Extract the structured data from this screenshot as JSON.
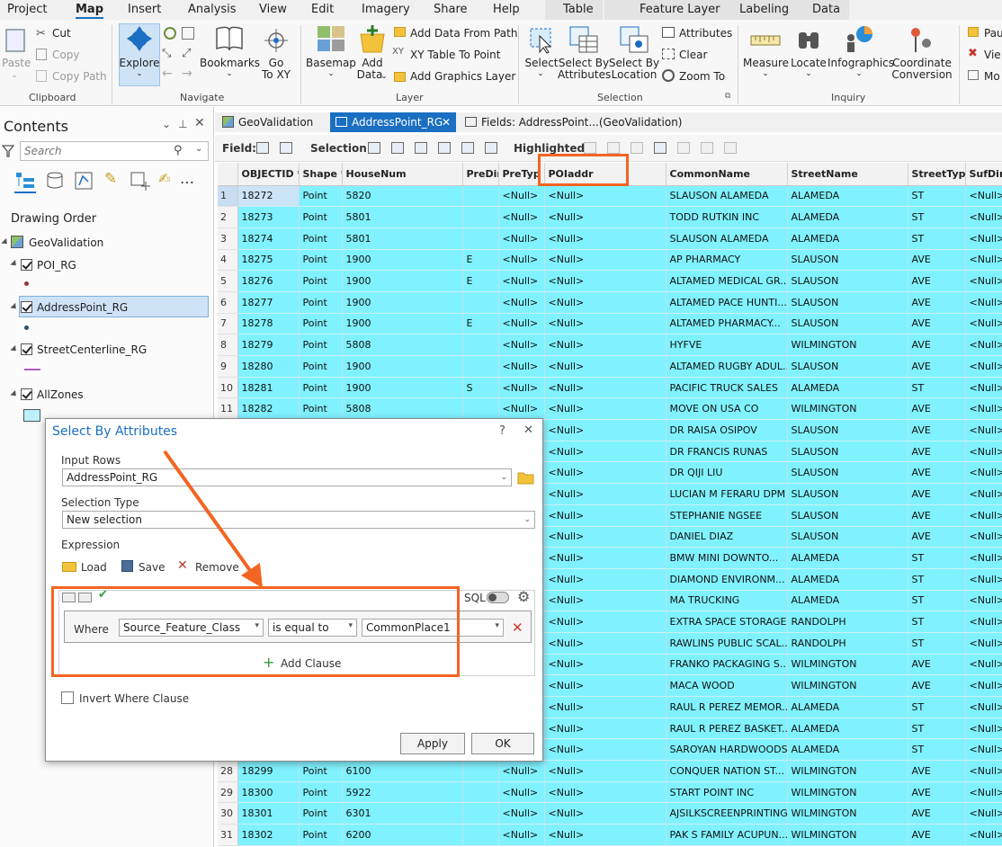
{
  "menu": {
    "items": [
      "Project",
      "Map",
      "Insert",
      "Analysis",
      "View",
      "Edit",
      "Imagery",
      "Share",
      "Help"
    ],
    "contextual": [
      "Table",
      "Feature Layer",
      "Labeling",
      "Data"
    ]
  },
  "ribbon": {
    "clipboard": {
      "paste": "Paste",
      "cut": "Cut",
      "copy": "Copy",
      "copy_path": "Copy Path",
      "label": "Clipboard"
    },
    "navigate": {
      "explore": "Explore",
      "bookmarks": "Bookmarks",
      "goto_xy": [
        "Go",
        "To XY"
      ],
      "label": "Navigate"
    },
    "layer": {
      "basemap": "Basemap",
      "add_data": [
        "Add",
        "Data"
      ],
      "add_data_from_path": "Add Data From Path",
      "xy_table_to_point": "XY Table To Point",
      "add_graphics_layer": "Add Graphics Layer",
      "label": "Layer"
    },
    "selection": {
      "select": "Select",
      "select_by_attributes": [
        "Select By",
        "Attributes"
      ],
      "select_by_location": [
        "Select By",
        "Location"
      ],
      "attributes": "Attributes",
      "clear": "Clear",
      "zoom_to": "Zoom To",
      "label": "Selection"
    },
    "inquiry": {
      "measure": "Measure",
      "locate": "Locate",
      "infographics": "Infographics",
      "coordinate_conversion": [
        "Coordinate",
        "Conversion"
      ],
      "label": "Inquiry"
    },
    "overflow": {
      "pause": "Pau",
      "view": "Vie",
      "more": "Mo"
    }
  },
  "contents": {
    "title": "Contents",
    "search_placeholder": "Search",
    "drawing_order": "Drawing Order",
    "map": "GeoValidation",
    "layers": [
      {
        "name": "POI_RG",
        "symbol_color": "#8b3a3a"
      },
      {
        "name": "AddressPoint_RG",
        "symbol_color": "#2d4f6b"
      },
      {
        "name": "StreetCenterline_RG",
        "symbol_color": "#b05cc8"
      },
      {
        "name": "AllZones",
        "symbol_color": "#bdf0ff"
      }
    ]
  },
  "tabs": [
    {
      "label": "GeoValidation",
      "active": false
    },
    {
      "label": "AddressPoint_RG",
      "active": true
    },
    {
      "label": "Fields: AddressPoint...(GeoValidation)",
      "active": false
    }
  ],
  "table_toolbar": {
    "field": "Field:",
    "selection": "Selection:",
    "highlighted": "Highlighted:"
  },
  "table": {
    "columns": [
      "OBJECTID *",
      "Shape *",
      "HouseNum",
      "PreDir",
      "PreTyp",
      "POIaddr",
      "CommonName",
      "StreetName",
      "StreetType",
      "SufDir"
    ],
    "rows": [
      [
        "1",
        "18272",
        "Point",
        "5820",
        "",
        "<Null>",
        "<Null>",
        "SLAUSON ALAMEDA",
        "ALAMEDA",
        "ST",
        "<Null>"
      ],
      [
        "2",
        "18273",
        "Point",
        "5801",
        "",
        "<Null>",
        "<Null>",
        "TODD RUTKIN INC",
        "ALAMEDA",
        "ST",
        "<Null>"
      ],
      [
        "3",
        "18274",
        "Point",
        "5801",
        "",
        "<Null>",
        "<Null>",
        "SLAUSON ALAMEDA",
        "ALAMEDA",
        "ST",
        "<Null>"
      ],
      [
        "4",
        "18275",
        "Point",
        "1900",
        "E",
        "<Null>",
        "<Null>",
        "AP PHARMACY",
        "SLAUSON",
        "AVE",
        "<Null>"
      ],
      [
        "5",
        "18276",
        "Point",
        "1900",
        "E",
        "<Null>",
        "<Null>",
        "ALTAMED MEDICAL GR...",
        "SLAUSON",
        "AVE",
        "<Null>"
      ],
      [
        "6",
        "18277",
        "Point",
        "1900",
        "",
        "<Null>",
        "<Null>",
        "ALTAMED PACE HUNTI...",
        "SLAUSON",
        "AVE",
        "<Null>"
      ],
      [
        "7",
        "18278",
        "Point",
        "1900",
        "E",
        "<Null>",
        "<Null>",
        "ALTAMED PHARMACY...",
        "SLAUSON",
        "AVE",
        "<Null>"
      ],
      [
        "8",
        "18279",
        "Point",
        "5808",
        "",
        "<Null>",
        "<Null>",
        "HYFVE",
        "WILMINGTON",
        "AVE",
        "<Null>"
      ],
      [
        "9",
        "18280",
        "Point",
        "1900",
        "",
        "<Null>",
        "<Null>",
        "ALTAMED RUGBY ADUL...",
        "SLAUSON",
        "AVE",
        "<Null>"
      ],
      [
        "10",
        "18281",
        "Point",
        "1900",
        "S",
        "<Null>",
        "<Null>",
        "PACIFIC TRUCK SALES",
        "ALAMEDA",
        "ST",
        "<Null>"
      ],
      [
        "11",
        "18282",
        "Point",
        "5808",
        "",
        "<Null>",
        "<Null>",
        "MOVE ON USA CO",
        "WILMINGTON",
        "AVE",
        "<Null>"
      ],
      [
        "",
        "",
        "",
        "",
        "",
        "<Null>",
        "<Null>",
        "DR RAISA OSIPOV",
        "SLAUSON",
        "AVE",
        "<Null>"
      ],
      [
        "",
        "",
        "",
        "",
        "",
        "<Null>",
        "<Null>",
        "DR FRANCIS RUNAS",
        "SLAUSON",
        "AVE",
        "<Null>"
      ],
      [
        "",
        "",
        "",
        "",
        "",
        "<Null>",
        "<Null>",
        "DR QIJI LIU",
        "SLAUSON",
        "AVE",
        "<Null>"
      ],
      [
        "",
        "",
        "",
        "",
        "",
        "<Null>",
        "<Null>",
        "LUCIAN M FERARU DPM",
        "SLAUSON",
        "AVE",
        "<Null>"
      ],
      [
        "",
        "",
        "",
        "",
        "",
        "<Null>",
        "<Null>",
        "STEPHANIE NGSEE",
        "SLAUSON",
        "AVE",
        "<Null>"
      ],
      [
        "",
        "",
        "",
        "",
        "",
        "<Null>",
        "<Null>",
        "DANIEL DIAZ",
        "SLAUSON",
        "AVE",
        "<Null>"
      ],
      [
        "",
        "",
        "",
        "",
        "",
        "<Null>",
        "<Null>",
        "BMW MINI DOWNTO...",
        "ALAMEDA",
        "ST",
        "<Null>"
      ],
      [
        "",
        "",
        "",
        "",
        "",
        "<Null>",
        "<Null>",
        "DIAMOND ENVIRONM...",
        "ALAMEDA",
        "ST",
        "<Null>"
      ],
      [
        "",
        "",
        "",
        "",
        "",
        "<Null>",
        "<Null>",
        "MA TRUCKING",
        "ALAMEDA",
        "ST",
        "<Null>"
      ],
      [
        "",
        "",
        "",
        "",
        "",
        "<Null>",
        "<Null>",
        "EXTRA SPACE STORAGE",
        "RANDOLPH",
        "ST",
        "<Null>"
      ],
      [
        "",
        "",
        "",
        "",
        "",
        "<Null>",
        "<Null>",
        "RAWLINS PUBLIC SCAL...",
        "RANDOLPH",
        "ST",
        "<Null>"
      ],
      [
        "",
        "",
        "",
        "",
        "",
        "<Null>",
        "<Null>",
        "FRANKO PACKAGING S...",
        "WILMINGTON",
        "AVE",
        "<Null>"
      ],
      [
        "",
        "",
        "",
        "",
        "",
        "<Null>",
        "<Null>",
        "MACA WOOD",
        "WILMINGTON",
        "AVE",
        "<Null>"
      ],
      [
        "",
        "",
        "",
        "",
        "",
        "<Null>",
        "<Null>",
        "RAUL R PEREZ MEMOR...",
        "ALAMEDA",
        "ST",
        "<Null>"
      ],
      [
        "",
        "",
        "",
        "",
        "",
        "<Null>",
        "<Null>",
        "RAUL R PEREZ BASKET...",
        "ALAMEDA",
        "ST",
        "<Null>"
      ],
      [
        "",
        "",
        "",
        "",
        "",
        "<Null>",
        "<Null>",
        "SAROYAN HARDWOODS",
        "ALAMEDA",
        "ST",
        "<Null>"
      ],
      [
        "28",
        "18299",
        "Point",
        "6100",
        "",
        "<Null>",
        "<Null>",
        "CONQUER NATION ST...",
        "WILMINGTON",
        "AVE",
        "<Null>"
      ],
      [
        "29",
        "18300",
        "Point",
        "5922",
        "",
        "<Null>",
        "<Null>",
        "START POINT INC",
        "WILMINGTON",
        "AVE",
        "<Null>"
      ],
      [
        "30",
        "18301",
        "Point",
        "6301",
        "",
        "<Null>",
        "<Null>",
        "AJSILKSCREENPRINTING",
        "WILMINGTON",
        "AVE",
        "<Null>"
      ],
      [
        "31",
        "18302",
        "Point",
        "6200",
        "",
        "<Null>",
        "<Null>",
        "PAK S FAMILY ACUPUN...",
        "WILMINGTON",
        "AVE",
        "<Null>"
      ]
    ]
  },
  "dialog": {
    "title": "Select By Attributes",
    "help": "?",
    "input_rows_label": "Input Rows",
    "input_rows_value": "AddressPoint_RG",
    "selection_type_label": "Selection Type",
    "selection_type_value": "New selection",
    "expression_label": "Expression",
    "load": "Load",
    "save": "Save",
    "remove": "Remove",
    "sql_label": "SQL",
    "where": "Where",
    "field_value": "Source_Feature_Class",
    "operator_value": "is equal to",
    "value_value": "CommonPlace1",
    "add_clause": "Add Clause",
    "invert_where": "Invert Where Clause",
    "apply": "Apply",
    "ok": "OK"
  },
  "colors": {
    "accent": "#1b6fc2",
    "highlight_annotation": "#f26522",
    "selected_row": "#80f2ff"
  }
}
